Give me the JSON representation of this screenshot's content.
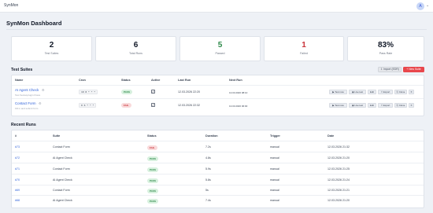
{
  "topbar": {
    "brand": "SynMon",
    "avatar_initial": "A",
    "caret": "⌄"
  },
  "page_title": "SynMon Dashboard",
  "stats": [
    {
      "value": "2",
      "label": "Test Suites",
      "color": "#111827"
    },
    {
      "value": "6",
      "label": "Total Runs",
      "color": "#111827"
    },
    {
      "value": "5",
      "label": "Passed",
      "color": "#2f8a4b"
    },
    {
      "value": "1",
      "label": "Failed",
      "color": "#c9343b"
    },
    {
      "value": "83%",
      "label": "Pass Rate",
      "color": "#111827"
    }
  ],
  "test_suites": {
    "title": "Test Suites",
    "import_label": "⇩ Import (EDR)",
    "new_label": "+ New Suite",
    "headers": {
      "name": "Name",
      "cron": "Cron",
      "status": "Status",
      "active": "Active",
      "last_run": "Last Run",
      "next_run": "Next Run"
    },
    "rows": [
      {
        "name": "AI Agent Check",
        "gear": "⚙",
        "subtitle": "Test Social-plugin Flows",
        "cron": "10 8 * * *",
        "status": "PASS",
        "active": "✓",
        "last_run": "12.03.2026 22:20",
        "next_run": "13.03.2026 08:10"
      },
      {
        "name": "Contact Form",
        "gear": "⚙",
        "subtitle": "Fill in and submit form",
        "cron": "0 6 * * *",
        "status": "FAIL",
        "active": "✓",
        "last_run": "12.03.2026 22:32",
        "next_run": "13.03.2026 06:00"
      }
    ],
    "actions": [
      "▶ Test now",
      "◉ Live test",
      "Edit",
      "⇧ Export",
      "⎘ Clone",
      "✕"
    ]
  },
  "recent_runs": {
    "title": "Recent Runs",
    "headers": {
      "id": "#",
      "suite": "Suite",
      "status": "Status",
      "duration": "Duration",
      "trigger": "Trigger",
      "date": "Date"
    },
    "rows": [
      {
        "id": "#73",
        "suite": "Contact Form",
        "status": "FAIL",
        "duration": "7.2s",
        "trigger": "manual",
        "date": "12.03.2026 21:32"
      },
      {
        "id": "#72",
        "suite": "AI Agent Check",
        "status": "PASS",
        "duration": "4.8s",
        "trigger": "manual",
        "date": "12.03.2026 21:20"
      },
      {
        "id": "#71",
        "suite": "Contact Form",
        "status": "PASS",
        "duration": "5.9s",
        "trigger": "manual",
        "date": "12.03.2026 21:25"
      },
      {
        "id": "#70",
        "suite": "AI Agent Check",
        "status": "PASS",
        "duration": "5.8s",
        "trigger": "manual",
        "date": "12.03.2026 21:24"
      },
      {
        "id": "#69",
        "suite": "Contact Form",
        "status": "PASS",
        "duration": "5s",
        "trigger": "manual",
        "date": "12.03.2026 21:21"
      },
      {
        "id": "#68",
        "suite": "AI Agent Check",
        "status": "PASS",
        "duration": "7.4s",
        "trigger": "manual",
        "date": "12.03.2026 21:20"
      }
    ]
  }
}
